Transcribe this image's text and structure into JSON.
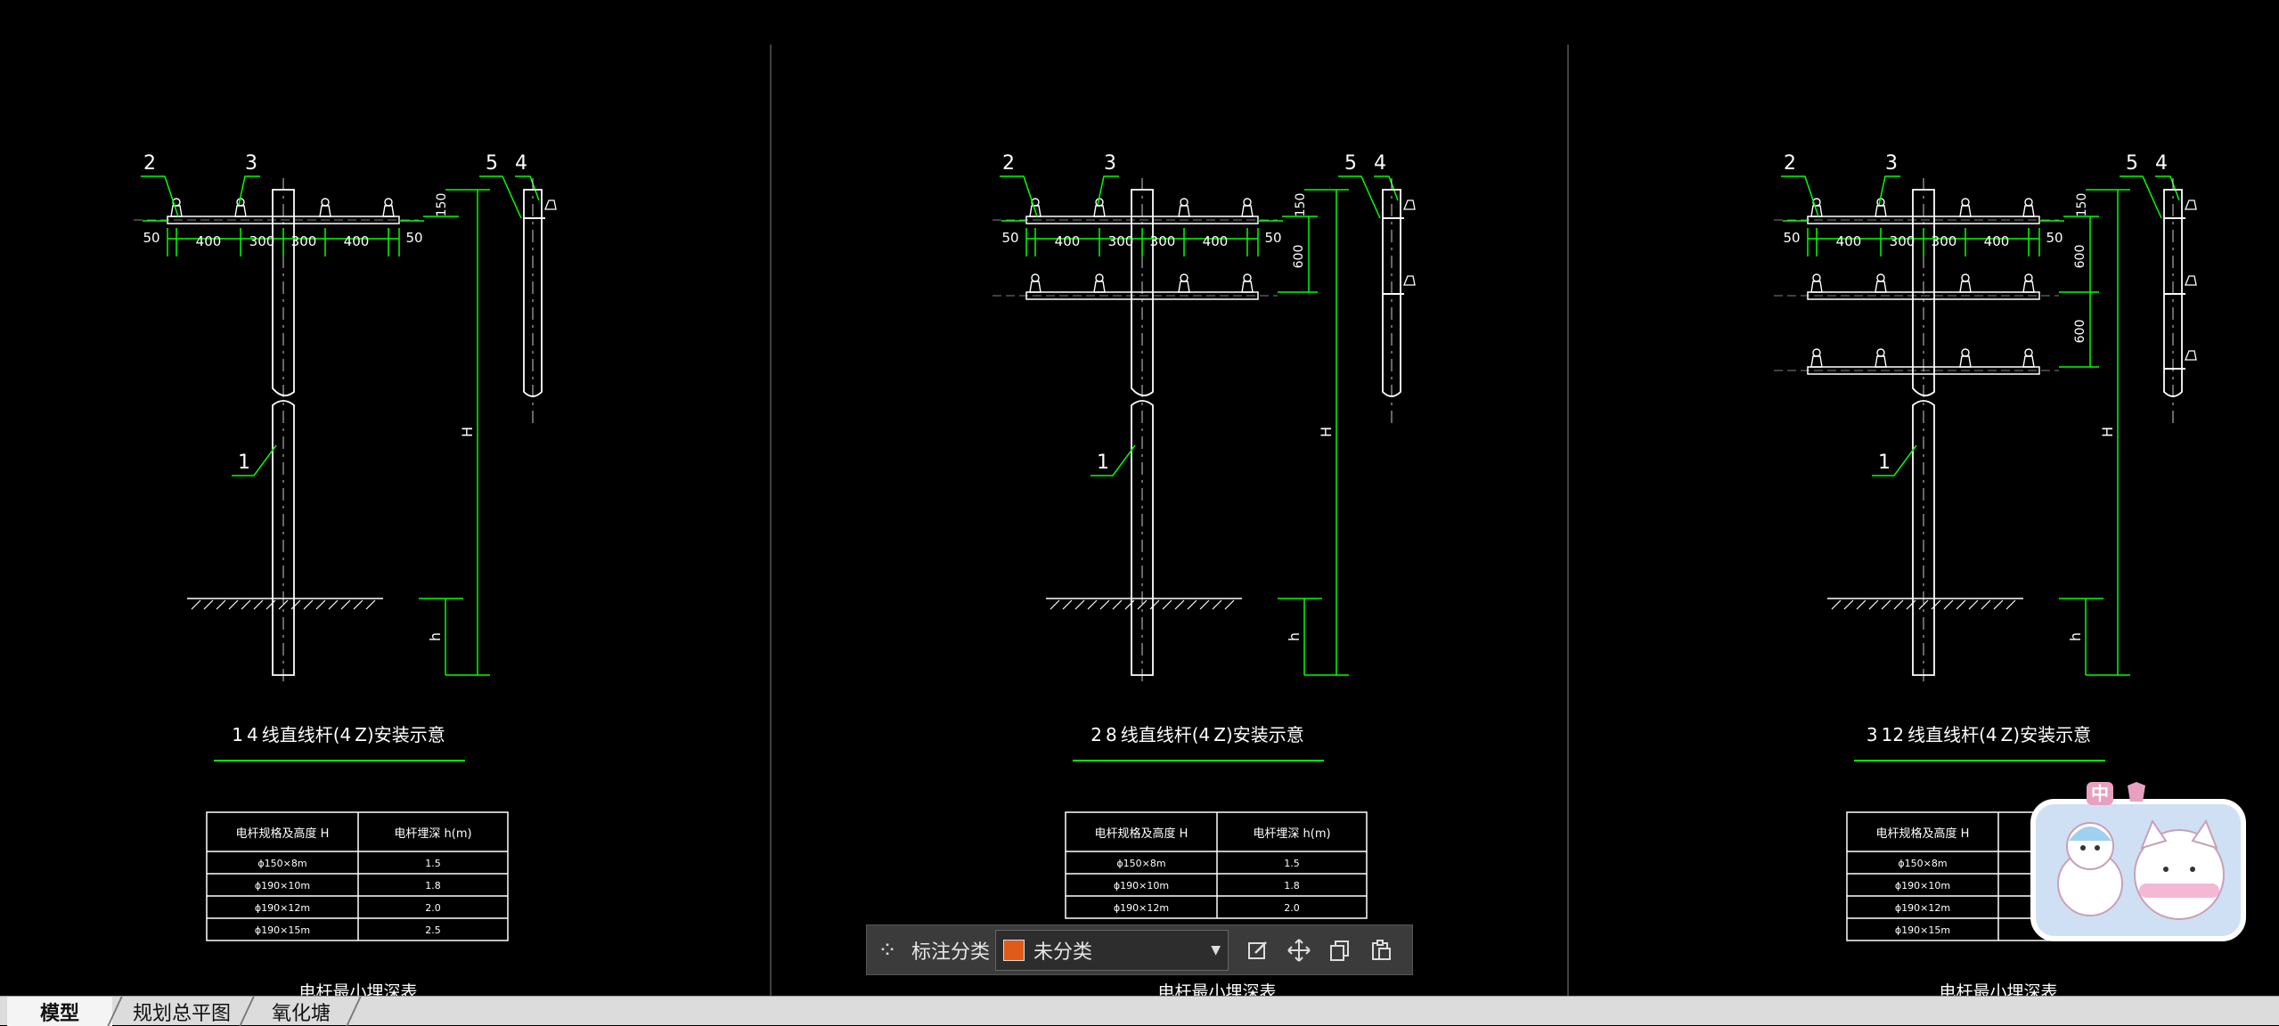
{
  "colors": {
    "background": "#000000",
    "geometry": "#ffffff",
    "dimension": "#00ff00",
    "accent": "#e05a1a"
  },
  "panels": [
    {
      "title": "1 4 线直线杆(4 Z)安装示意",
      "dims": {
        "left_end": "50",
        "right_end": "50",
        "s1": "400",
        "s2": "300",
        "s3": "300",
        "s4": "400",
        "top": "150",
        "gap1": "",
        "gap2": "",
        "height": "H",
        "depth": "h"
      },
      "callouts": {
        "c1": "1",
        "c2": "2",
        "c3": "3",
        "c4": "4",
        "c5": "5"
      },
      "table": {
        "headers": [
          "电杆规格及高度  H",
          "电杆埋深  h(m)"
        ],
        "rows": [
          [
            "ϕ150×8m",
            "1.5"
          ],
          [
            "ϕ190×10m",
            "1.8"
          ],
          [
            "ϕ190×12m",
            "2.0"
          ],
          [
            "ϕ190×15m",
            "2.5"
          ]
        ],
        "caption": "电杆最小埋深表"
      }
    },
    {
      "title": "2 8 线直线杆(4 Z)安装示意",
      "dims": {
        "left_end": "50",
        "right_end": "50",
        "s1": "400",
        "s2": "300",
        "s3": "300",
        "s4": "400",
        "top": "150",
        "gap1": "600",
        "gap2": "",
        "height": "H",
        "depth": "h"
      },
      "callouts": {
        "c1": "1",
        "c2": "2",
        "c3": "3",
        "c4": "4",
        "c5": "5"
      },
      "table": {
        "headers": [
          "电杆规格及高度  H",
          "电杆埋深  h(m)"
        ],
        "rows": [
          [
            "ϕ150×8m",
            "1.5"
          ],
          [
            "ϕ190×10m",
            "1.8"
          ],
          [
            "ϕ190×12m",
            "2.0"
          ]
        ],
        "caption": "电杆最小埋深表"
      }
    },
    {
      "title": "3 12 线直线杆(4 Z)安装示意",
      "dims": {
        "left_end": "50",
        "right_end": "50",
        "s1": "400",
        "s2": "300",
        "s3": "300",
        "s4": "400",
        "top": "150",
        "gap1": "600",
        "gap2": "600",
        "height": "H",
        "depth": "h"
      },
      "callouts": {
        "c1": "1",
        "c2": "2",
        "c3": "3",
        "c4": "4",
        "c5": "5"
      },
      "table": {
        "headers": [
          "电杆规格及高度  H",
          "电"
        ],
        "rows": [
          [
            "ϕ150×8m",
            ""
          ],
          [
            "ϕ190×10m",
            ""
          ],
          [
            "ϕ190×12m",
            ""
          ],
          [
            "ϕ190×15m",
            ""
          ]
        ],
        "caption": "电杆最小埋深表"
      }
    }
  ],
  "toolbar": {
    "grid_icon": "four-circles-icon",
    "label": "标注分类",
    "select_value": "未分类",
    "icons": [
      "edit-icon",
      "move-icon",
      "copy-icon",
      "paste-icon"
    ]
  },
  "tabs": [
    {
      "label": "模型",
      "active": true
    },
    {
      "label": "规划总平图",
      "active": false
    },
    {
      "label": "氧化塘",
      "active": false
    }
  ],
  "sticker": {
    "badge": "中"
  }
}
